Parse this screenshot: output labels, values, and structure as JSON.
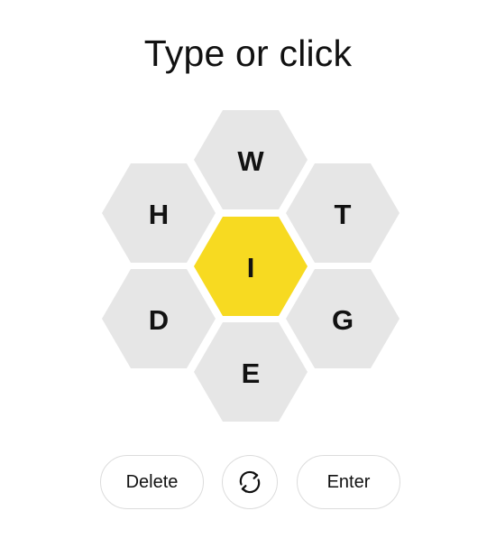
{
  "prompt": "Type or click",
  "hive": {
    "center_color": "#f7da21",
    "outer_color": "#e6e6e6",
    "letters": {
      "center": "I",
      "top": "W",
      "upper_left": "H",
      "upper_right": "T",
      "lower_left": "D",
      "lower_right": "G",
      "bottom": "E"
    }
  },
  "controls": {
    "delete_label": "Delete",
    "shuffle_icon": "shuffle-icon",
    "enter_label": "Enter"
  }
}
